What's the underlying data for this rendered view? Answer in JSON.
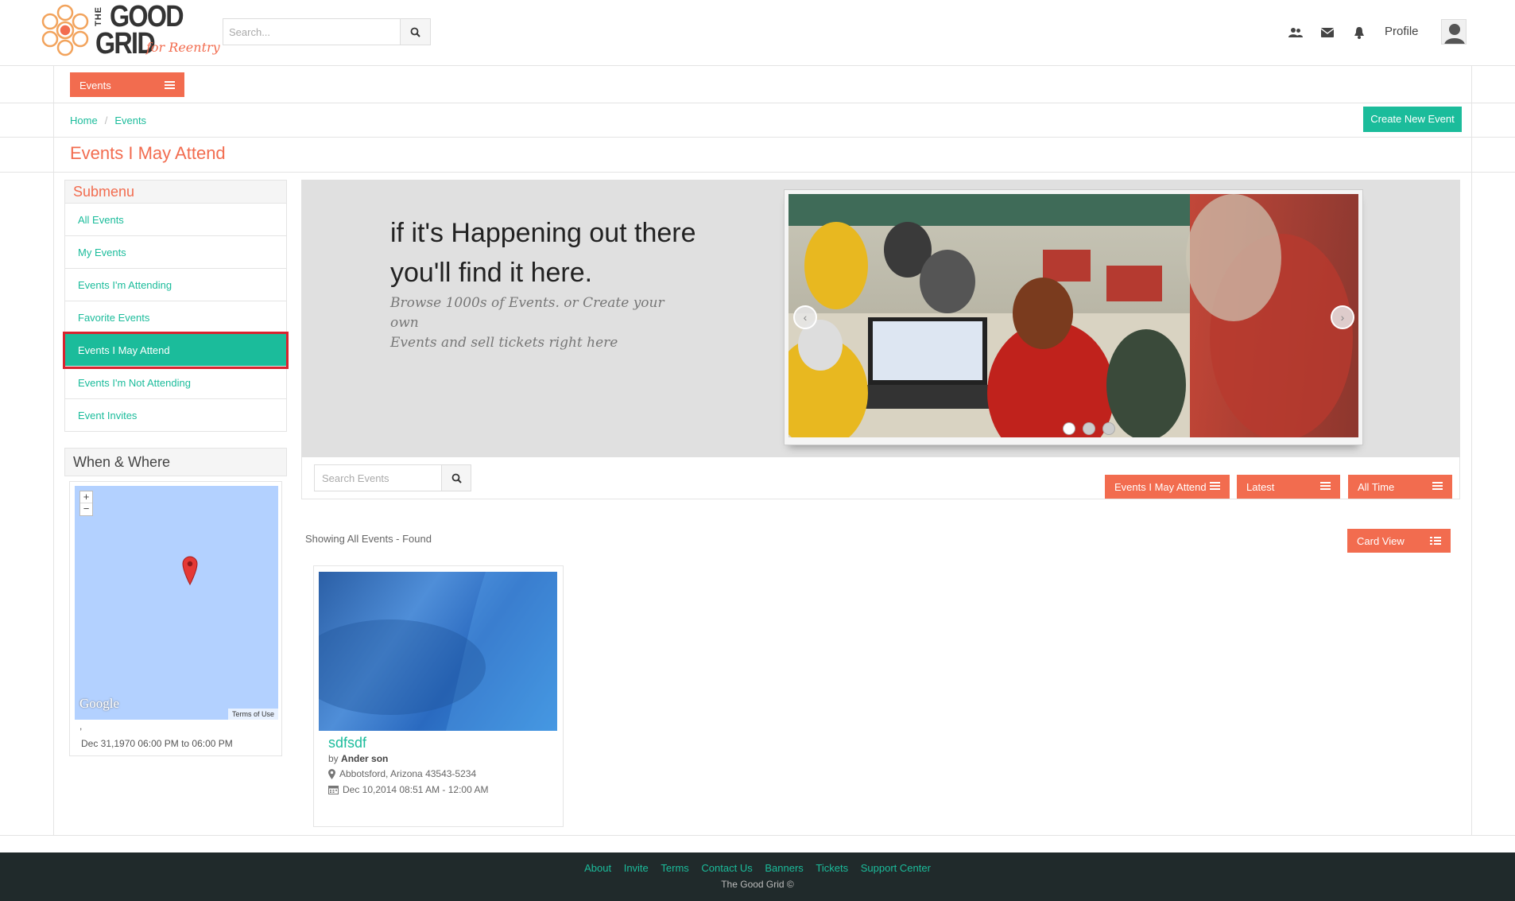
{
  "header": {
    "logo": {
      "the": "THE",
      "good": "GOOD",
      "grid": "GRID",
      "tagline": "for Reentry"
    },
    "search_placeholder": "Search...",
    "profile_label": "Profile"
  },
  "nav": {
    "events_menu_label": "Events"
  },
  "breadcrumb": {
    "home": "Home",
    "separator": "/",
    "current": "Events"
  },
  "actions": {
    "create_event": "Create New Event"
  },
  "page_title": "Events I May Attend",
  "submenu": {
    "title": "Submenu",
    "items": [
      {
        "label": "All Events"
      },
      {
        "label": "My Events"
      },
      {
        "label": "Events I'm Attending"
      },
      {
        "label": "Favorite Events"
      },
      {
        "label": "Events I May Attend"
      },
      {
        "label": "Events I'm Not Attending"
      },
      {
        "label": "Event Invites"
      }
    ],
    "active_index": 4
  },
  "when_where": {
    "title": "When & Where",
    "zoom_in": "+",
    "zoom_out": "−",
    "map_brand": "Google",
    "map_terms": "Terms of Use",
    "address": ",",
    "date_range": "Dec 31,1970 06:00 PM to 06:00 PM"
  },
  "banner": {
    "headline_line1": "if it's Happening out there",
    "headline_line2": "you'll find it here.",
    "subtext_line1": "Browse 1000s of Events. or Create your own",
    "subtext_line2": "Events and sell tickets right here",
    "prev_arrow": "‹",
    "next_arrow": "›",
    "slide_count": 3,
    "active_slide": 0
  },
  "filters": {
    "search_placeholder": "Search Events",
    "type": "Events I May Attend",
    "sort": "Latest",
    "period": "All Time"
  },
  "results": {
    "showing_text": "Showing All Events - Found",
    "view_label": "Card View"
  },
  "event": {
    "title": "sdfsdf",
    "by_prefix": "by",
    "author": "Ander son",
    "location": "Abbotsford, Arizona 43543-5234",
    "date": "Dec 10,2014 08:51 AM - 12:00 AM"
  },
  "footer": {
    "links": [
      "About",
      "Invite",
      "Terms",
      "Contact Us",
      "Banners",
      "Tickets",
      "Support Center"
    ],
    "copyright": "The Good Grid ©"
  },
  "colors": {
    "accent_teal": "#1bbc9b",
    "accent_orange": "#f26c4f",
    "highlight_red": "#d9232e",
    "footer_bg": "#202a2b"
  }
}
